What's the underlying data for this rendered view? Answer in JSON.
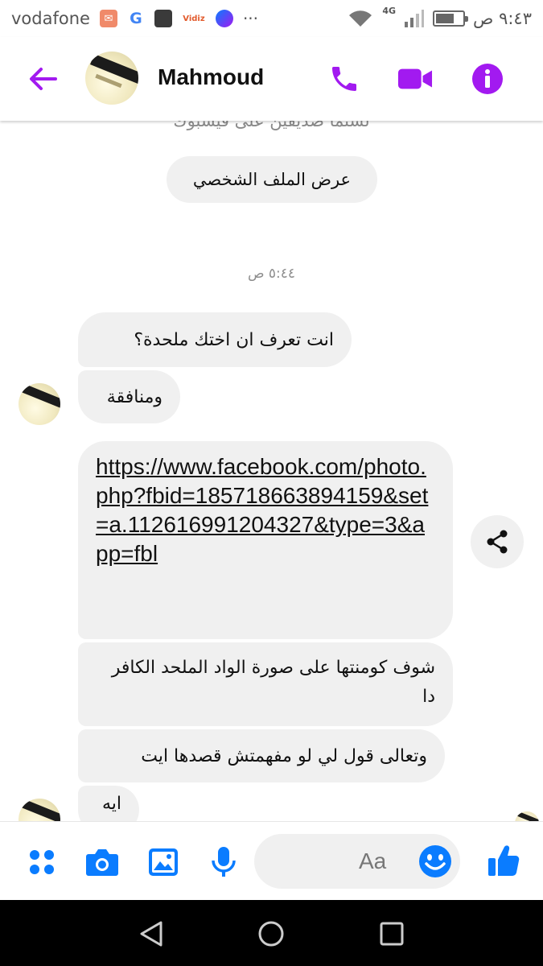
{
  "status_bar": {
    "carrier": "vodafone",
    "network": "4G",
    "time": "٩:٤٣ ص",
    "battery_level": 0.7,
    "notification_icons": [
      "mail-app-icon",
      "google-icon",
      "gallery-icon",
      "vidiz-icon",
      "messenger-icon"
    ],
    "more": "···",
    "vidiz_label": "Vidiz"
  },
  "header": {
    "contact_name": "Mahmoud"
  },
  "chat": {
    "friend_note": "لستما صديقين على فيسبوك",
    "view_profile_label": "عرض الملف الشخصي",
    "timestamp": "٥:٤٤ ص",
    "messages": [
      "انت تعرف ان اختك ملحدة؟",
      "ومنافقة",
      "https://www.facebook.com/photo.php?fbid=185718663894159&set=a.112616991204327&type=3&app=fbl",
      "شوف كومنتها على صورة الواد الملحد الكافر دا",
      "وتعالى قول لي لو مفهمتش قصدها ايت",
      "ايه"
    ]
  },
  "composer": {
    "placeholder": "Aa"
  },
  "colors": {
    "messenger_purple": "#A21AF0",
    "messenger_blue": "#0A7CFF",
    "bubble_gray": "#F0F0F0"
  }
}
